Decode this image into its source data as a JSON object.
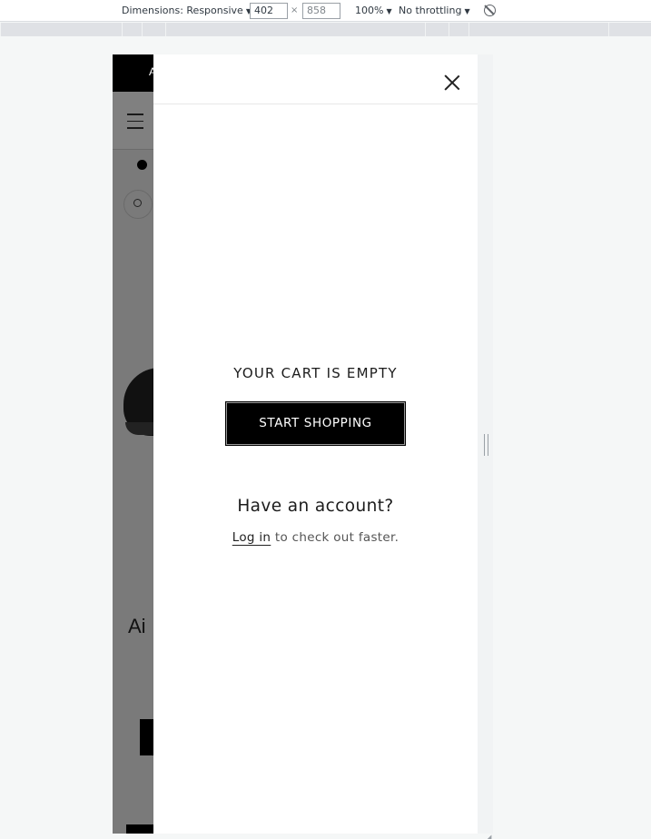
{
  "devtools": {
    "dimensions_label": "Dimensions: Responsive",
    "width_value": "402",
    "height_value": "858",
    "times": "×",
    "zoom": "100%",
    "throttling": "No throttling",
    "caret": "▼"
  },
  "background_page": {
    "announcement_text": "A",
    "product_title": "Ai"
  },
  "cart": {
    "empty_title": "YOUR CART IS EMPTY",
    "start_button": "START SHOPPING",
    "account_title": "Have an account?",
    "login_link": "Log in",
    "login_suffix": " to check out faster."
  },
  "icons": [
    "close-icon",
    "menu-icon",
    "zoom-icon",
    "check-icon",
    "rotate-icon",
    "resize-handle-icon"
  ],
  "colors": {
    "drawer_bg": "#ffffff",
    "button_bg": "#000000",
    "overlay": "#7a7a7a"
  }
}
